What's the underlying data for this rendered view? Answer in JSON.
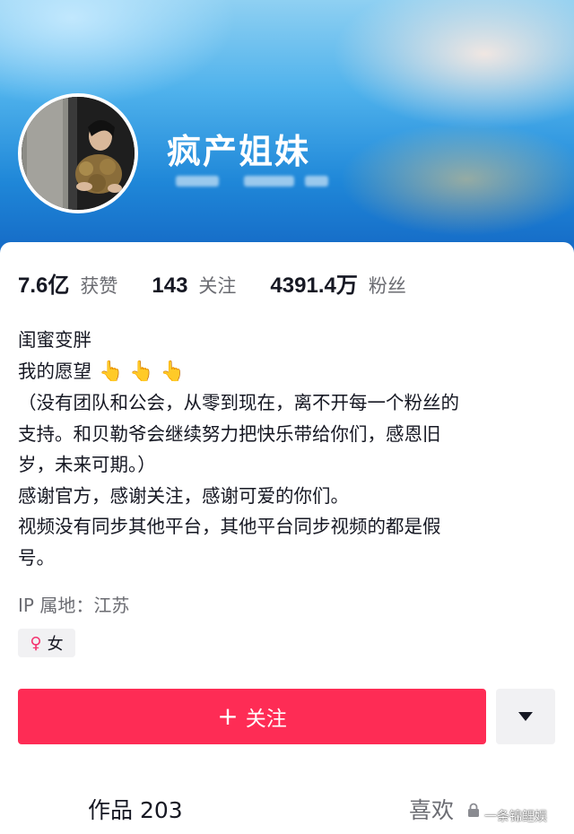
{
  "profile": {
    "nickname": "疯产姐妹",
    "gender": "女",
    "ip_location": "IP 属地：江苏"
  },
  "stats": [
    {
      "value": "7.6亿",
      "label": "获赞"
    },
    {
      "value": "143",
      "label": "关注"
    },
    {
      "value": "4391.4万",
      "label": "粉丝"
    }
  ],
  "bio": {
    "line1": "闺蜜变胖",
    "line2": "我的愿望",
    "line2_emoji": "👆 👆 👆",
    "line3": "（没有团队和公会，从零到现在，离不开每一个粉丝的",
    "line4": "支持。和贝勒爷会继续努力把快乐带给你们，感恩旧",
    "line5": "岁，未来可期。）",
    "line6": "感谢官方，感谢关注，感谢可爱的你们。",
    "line7": "视频没有同步其他平台，其他平台同步视频的都是假",
    "line8": "号。"
  },
  "actions": {
    "follow_label": "关注",
    "follow_icon": "plus-icon",
    "more_icon": "dropdown-triangle-icon"
  },
  "tabs": {
    "works": "作品 203",
    "likes": "喜欢"
  },
  "watermark": "一条锦鲤娱",
  "colors": {
    "follow_button": "#fe2c55",
    "gender_icon": "#f4306d",
    "header_blue": "#1f87d8"
  }
}
